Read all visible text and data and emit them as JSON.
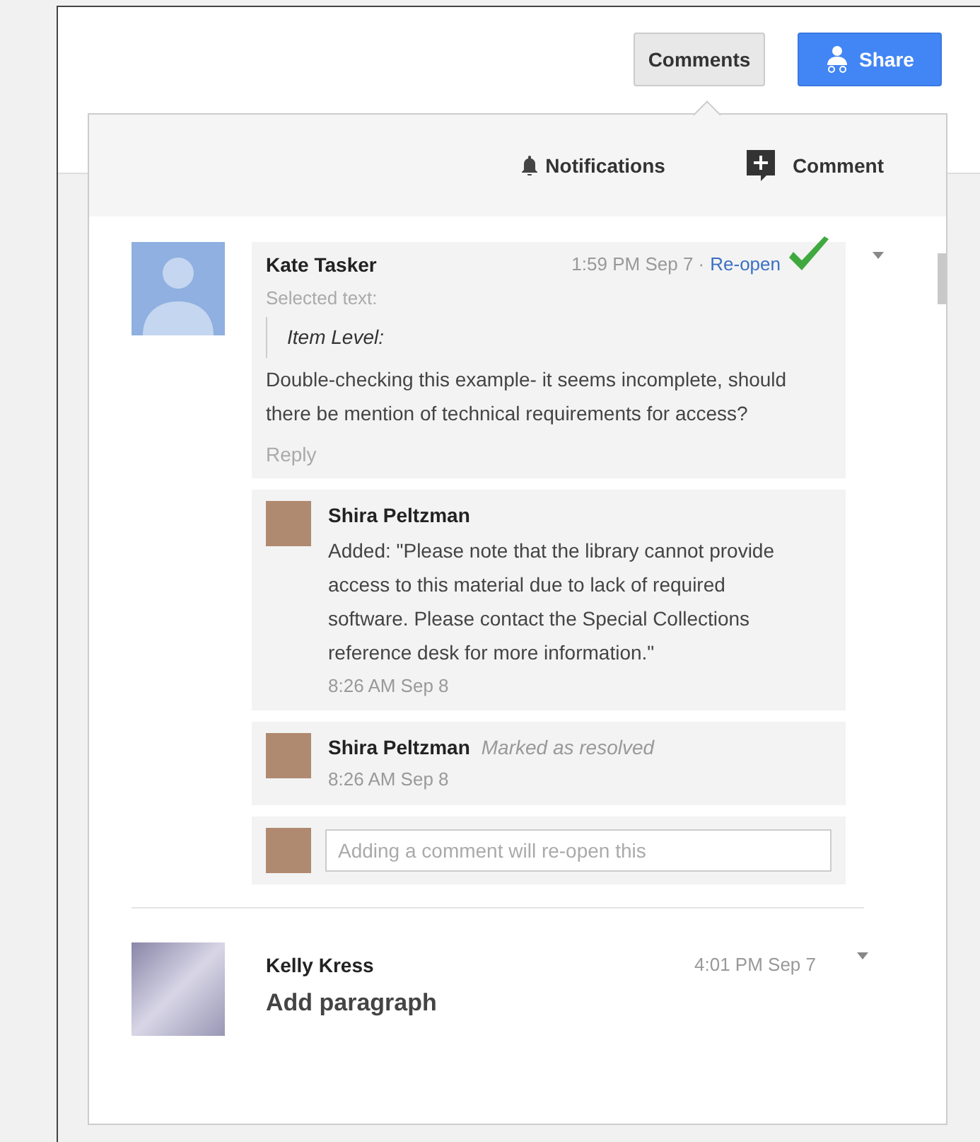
{
  "top_bar": {
    "buttons": [
      {
        "label": "Comments",
        "kind": "plain"
      },
      {
        "label": "Share",
        "kind": "primary"
      }
    ]
  },
  "comments_panel": {
    "toolbar": {
      "notifications": "Notifications",
      "comment": "Comment"
    },
    "threads": [
      {
        "author": "Kate Tasker",
        "avatar": {
          "kind": "silhouette"
        },
        "time": "1:59 PM Sep 7 ·",
        "action": "Re-open",
        "resolved": true,
        "selected_label": "Selected text:",
        "quote": "Item Level:",
        "body": "Double-checking this example- it seems incomplete, should there be mention of technical requirements for access?",
        "reply_label": "Reply",
        "replies": [
          {
            "kind": "comment",
            "author": "Shira Peltzman",
            "text": "Added: \"Please note that the library cannot provide access to this material due to lack of required software. Please contact the Special Collections reference desk for more information.\"",
            "time": "8:26 AM Sep 8"
          },
          {
            "kind": "status",
            "author": "Shira Peltzman",
            "text": "Marked as resolved",
            "time": "8:26 AM Sep 8"
          }
        ],
        "reply_field": {
          "placeholder": "Adding a comment will re-open this"
        }
      },
      {
        "author": "Kelly Kress",
        "avatar": {
          "kind": "photo"
        },
        "time": "4:01 PM Sep 7",
        "resolved": false,
        "body": "Add paragraph"
      }
    ]
  }
}
